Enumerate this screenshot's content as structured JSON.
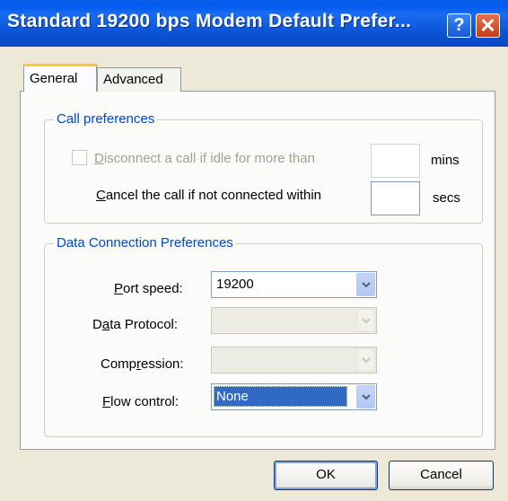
{
  "window": {
    "title": "Standard 19200 bps Modem Default Prefer...",
    "help_glyph": "?",
    "close_glyph": "✕"
  },
  "tabs": {
    "general": "General",
    "advanced": "Advanced"
  },
  "call_prefs": {
    "group_title": "Call preferences",
    "disconnect_label_pre": "",
    "disconnect_label_u": "D",
    "disconnect_label_post": "isconnect a call if idle for more than",
    "disconnect_checked": false,
    "disconnect_value": "",
    "disconnect_unit": "mins",
    "cancel_label_u": "C",
    "cancel_label_post": "ancel the call if not connected within",
    "cancel_value": "",
    "cancel_unit": "secs"
  },
  "data_prefs": {
    "group_title": "Data Connection Preferences",
    "port_speed_label_u": "P",
    "port_speed_label_post": "ort speed:",
    "port_speed_value": "19200",
    "protocol_label_pre": "D",
    "protocol_label_u": "a",
    "protocol_label_post": "ta Protocol:",
    "protocol_value": "",
    "compression_label_pre": "Comp",
    "compression_label_u": "r",
    "compression_label_post": "ession:",
    "compression_value": "",
    "flow_label_u": "F",
    "flow_label_post": "low control:",
    "flow_value": "None"
  },
  "buttons": {
    "ok": "OK",
    "cancel": "Cancel"
  },
  "colors": {
    "titlebar": "#0058ee",
    "group_title": "#0046d5",
    "selection": "#316ac5",
    "tab_highlight": "#ffc83c"
  }
}
